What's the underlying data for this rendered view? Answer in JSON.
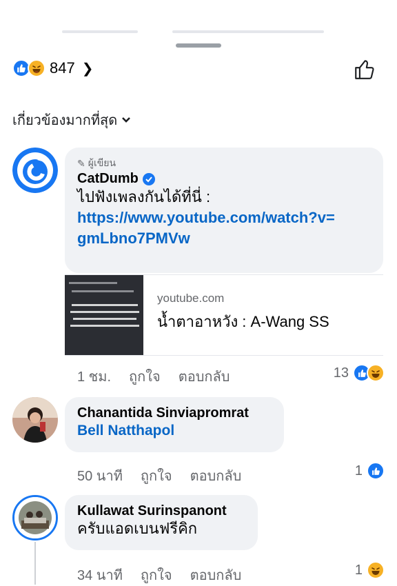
{
  "header": {
    "reaction_count": "847",
    "chevron": "❯",
    "icons": [
      "like-icon",
      "haha-icon",
      "like-outline-icon"
    ]
  },
  "sort": {
    "label": "เกี่ยวข้องมากที่สุด",
    "caret": "⌄"
  },
  "comments": [
    {
      "badge": "ผู้เขียน",
      "name": "CatDumb",
      "verified": true,
      "text": "ไปฟังเพลงกันได้ที่นี่ :",
      "link_line1": "https://www.youtube.com/watch?v=",
      "link_line2": "gmLbno7PMVw",
      "preview": {
        "domain": "youtube.com",
        "title": "น้ำตาอาหวัง : A-Wang SS"
      },
      "time": "1 ชม.",
      "like": "ถูกใจ",
      "reply": "ตอบกลับ",
      "count": "13"
    },
    {
      "name": "Chanantida Sinviapromrat",
      "mention": "Bell Natthapol",
      "time": "50 นาที",
      "like": "ถูกใจ",
      "reply": "ตอบกลับ",
      "count": "1"
    },
    {
      "name": "Kullawat Surinspanont",
      "text": "ครับแอดเบนฟรีคิก",
      "time": "34 นาที",
      "like": "ถูกใจ",
      "reply": "ตอบกลับ",
      "count": "1"
    }
  ],
  "colors": {
    "accent": "#1877f2",
    "link": "#0866c6",
    "bubble": "#f0f2f5",
    "meta": "#65676b"
  }
}
